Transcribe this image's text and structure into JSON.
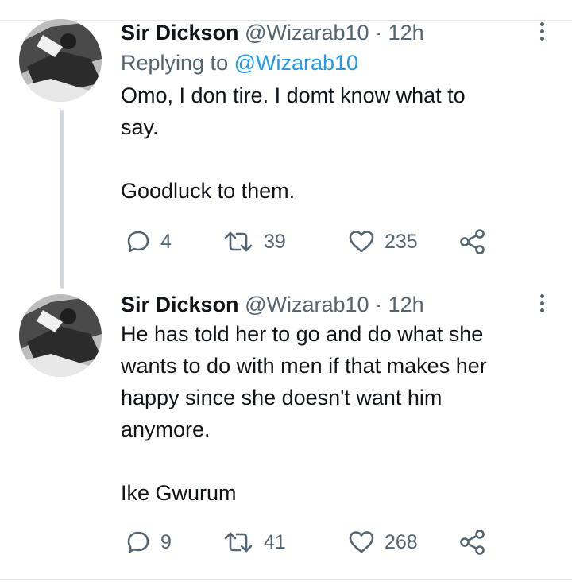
{
  "tweets": [
    {
      "author_name": "Sir Dickson",
      "handle": "@Wizarab10",
      "separator": "·",
      "time": "12h",
      "replying_label": "Replying to",
      "replying_to": "@Wizarab10",
      "text_lines": [
        "Omo, I don tire. I domt know what to",
        "say.",
        "Goodluck to them."
      ],
      "stats": {
        "replies": "4",
        "retweets": "39",
        "likes": "235"
      }
    },
    {
      "author_name": "Sir Dickson",
      "handle": "@Wizarab10",
      "separator": "·",
      "time": "12h",
      "text_lines": [
        "He has told her to go and do what she",
        "wants to do with men if that makes her",
        "happy since she doesn't want him",
        "anymore.",
        "Ike Gwurum"
      ],
      "stats": {
        "replies": "9",
        "retweets": "41",
        "likes": "268"
      }
    }
  ],
  "icons": {
    "reply": "reply-icon",
    "retweet": "retweet-icon",
    "like": "heart-icon",
    "share": "share-icon",
    "more": "more-options-icon"
  },
  "colors": {
    "text": "#0f1419",
    "secondary": "#536471",
    "link": "#1d9bf0",
    "thread_line": "#cfd9de"
  }
}
